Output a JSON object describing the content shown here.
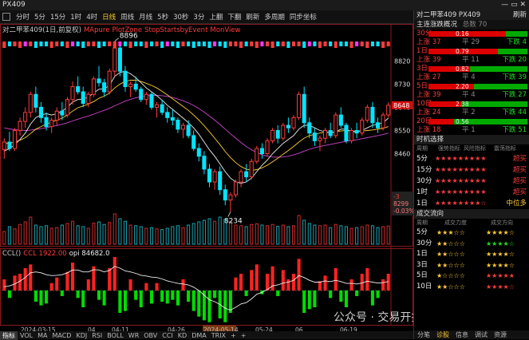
{
  "window": {
    "title": "PX409",
    "controls": "— ▭ ✕"
  },
  "toolbar": [
    "分时",
    "5分",
    "15分",
    "1时",
    "4时",
    "日线",
    "周线",
    "月线",
    "5秒",
    "30秒",
    "3分",
    "上翻",
    "下翻",
    "刷新",
    "多周期",
    "同步坐标"
  ],
  "toolbar_active": 5,
  "main": {
    "legend": [
      {
        "text": "对二甲苯409(1日,前复权)",
        "color": "#cccccc"
      },
      {
        "text": "MApure",
        "color": "#ff3b3b"
      },
      {
        "text": "PlotZone",
        "color": "#ff3b3b"
      },
      {
        "text": "StopStartsbyEvent",
        "color": "#ff3b3b"
      },
      {
        "text": "MonView",
        "color": "#ff3b3b"
      }
    ],
    "price_labels": [
      "8820",
      "8730",
      "8640",
      "8550",
      "8460"
    ],
    "price_values": [
      8820,
      8730,
      8640,
      8550,
      8460
    ],
    "ylim": [
      8220,
      8920
    ],
    "high_label": "8896",
    "low_label": "8234",
    "last_price": "8648",
    "side_tag": [
      "-3",
      "8299",
      "-0.03%"
    ]
  },
  "sub": {
    "legend": [
      {
        "text": "CCL()",
        "color": "#cccccc"
      },
      {
        "text": "CCL 1922.00",
        "color": "#ff3b3b"
      },
      {
        "text": "opi 84682.0",
        "color": "#eeeeee"
      }
    ]
  },
  "xaxis": [
    "2024-03-15",
    "04",
    "04-11",
    "04-26",
    "2024-05-14",
    "05-24",
    "06",
    "06-19"
  ],
  "bottom_tabs": [
    "指标",
    "VOL",
    "MA",
    "MACD",
    "KDJ",
    "RSI",
    "BOLL",
    "WR",
    "OBV",
    "CCI",
    "KD",
    "DMA",
    "TRIX",
    "+",
    "+"
  ],
  "watermark": "公众号 · 交易开拓者TB",
  "right": {
    "title": "对二甲苯409 PX409",
    "title_right": "刷新",
    "overview_title": "主连涨跌概况",
    "overview_sub": "总数 70",
    "periods": [
      {
        "label": "30分",
        "val": "0.16",
        "fill": 0.78,
        "up": "上涨 37",
        "flat": "平 29",
        "down": "下跌 4"
      },
      {
        "label": "1日",
        "val": "0.79",
        "fill": 0.7,
        "up": "上涨 39",
        "flat": "平 11",
        "down": "下跌 20"
      },
      {
        "label": "3日",
        "val": "0.82",
        "fill": 0.42,
        "up": "上涨 27",
        "flat": "平 4",
        "down": "下跌 39"
      },
      {
        "label": "5日",
        "val": "2.20",
        "fill": 0.46,
        "up": "上涨 39",
        "flat": "平 4",
        "down": "下跌 27"
      },
      {
        "label": "10日",
        "val": "2.38",
        "fill": 0.33,
        "up": "上涨 24",
        "flat": "平 2",
        "down": "下跌 44"
      },
      {
        "label": "20日",
        "val": "0.56",
        "fill": 0.26,
        "up": "上涨 18",
        "flat": "平 1",
        "down": "下跌 51"
      }
    ],
    "timing_title": "时机选择",
    "timing_cols": [
      "周期",
      "强势指标",
      "风险指标",
      "震荡指标"
    ],
    "timing_rows": [
      {
        "p": "5分",
        "stars": "★★★★★★★★★",
        "rating": "超买"
      },
      {
        "p": "15分",
        "stars": "★★★★★★★★★",
        "rating": "超买"
      },
      {
        "p": "30分",
        "stars": "★★★★★★★★★",
        "rating": "超买"
      },
      {
        "p": "1时",
        "stars": "★★★★★★★★★",
        "rating": "超买"
      },
      {
        "p": "1日",
        "stars": "★★★★★★★★☆",
        "rating": "中位多"
      }
    ],
    "flow_title": "成交流向",
    "flow_cols": [
      "周期",
      "成交力度",
      "成交方向"
    ],
    "flow_rows": [
      {
        "p": "5分",
        "a": "★★★☆☆",
        "b": "★★★★☆",
        "bc": "y"
      },
      {
        "p": "30分",
        "a": "★★☆☆☆",
        "b": "★★★★☆",
        "bc": "g"
      },
      {
        "p": "1日",
        "a": "★★☆☆☆",
        "b": "★★★★☆",
        "bc": "y"
      },
      {
        "p": "3日",
        "a": "★★☆☆☆",
        "b": "★★★★☆",
        "bc": "y"
      },
      {
        "p": "5日",
        "a": "★☆☆☆☆",
        "b": "★★★★★",
        "bc": "r"
      },
      {
        "p": "10日",
        "a": "★★☆☆☆",
        "b": "★★★★☆",
        "bc": "r"
      }
    ],
    "bottom_tabs": [
      "分笔",
      "诊股",
      "信息",
      "调试",
      "资源"
    ]
  },
  "colors": {
    "up": "#ff3b3b",
    "down": "#00e5ff",
    "ma1": "#eeeeee",
    "ma2": "#ffcc33",
    "ma3": "#cc44cc",
    "ccl_up": "#ff2222",
    "ccl_down": "#00dd00"
  },
  "chart_data": {
    "type": "candlestick",
    "ohlc": [
      [
        8475,
        8520,
        8440,
        8505
      ],
      [
        8505,
        8545,
        8470,
        8480
      ],
      [
        8480,
        8560,
        8470,
        8550
      ],
      [
        8550,
        8600,
        8530,
        8585
      ],
      [
        8585,
        8640,
        8560,
        8620
      ],
      [
        8620,
        8700,
        8600,
        8690
      ],
      [
        8690,
        8720,
        8620,
        8640
      ],
      [
        8640,
        8660,
        8580,
        8600
      ],
      [
        8600,
        8620,
        8550,
        8565
      ],
      [
        8565,
        8600,
        8540,
        8590
      ],
      [
        8590,
        8640,
        8570,
        8625
      ],
      [
        8625,
        8660,
        8590,
        8610
      ],
      [
        8610,
        8680,
        8600,
        8670
      ],
      [
        8670,
        8740,
        8650,
        8720
      ],
      [
        8720,
        8760,
        8690,
        8700
      ],
      [
        8700,
        8720,
        8640,
        8655
      ],
      [
        8655,
        8700,
        8640,
        8690
      ],
      [
        8690,
        8760,
        8680,
        8750
      ],
      [
        8750,
        8800,
        8720,
        8735
      ],
      [
        8735,
        8750,
        8680,
        8700
      ],
      [
        8700,
        8790,
        8690,
        8780
      ],
      [
        8780,
        8896,
        8760,
        8870
      ],
      [
        8870,
        8880,
        8760,
        8780
      ],
      [
        8780,
        8800,
        8700,
        8720
      ],
      [
        8720,
        8740,
        8680,
        8730
      ],
      [
        8730,
        8760,
        8700,
        8710
      ],
      [
        8710,
        8720,
        8660,
        8670
      ],
      [
        8670,
        8700,
        8650,
        8690
      ],
      [
        8690,
        8700,
        8630,
        8640
      ],
      [
        8640,
        8660,
        8600,
        8650
      ],
      [
        8650,
        8670,
        8610,
        8620
      ],
      [
        8620,
        8640,
        8580,
        8600
      ],
      [
        8600,
        8630,
        8570,
        8590
      ],
      [
        8590,
        8600,
        8540,
        8555
      ],
      [
        8555,
        8580,
        8520,
        8570
      ],
      [
        8570,
        8590,
        8520,
        8530
      ],
      [
        8530,
        8550,
        8470,
        8480
      ],
      [
        8480,
        8500,
        8430,
        8450
      ],
      [
        8450,
        8470,
        8380,
        8400
      ],
      [
        8400,
        8420,
        8330,
        8350
      ],
      [
        8350,
        8400,
        8320,
        8390
      ],
      [
        8390,
        8410,
        8300,
        8320
      ],
      [
        8320,
        8340,
        8260,
        8280
      ],
      [
        8280,
        8310,
        8234,
        8300
      ],
      [
        8300,
        8360,
        8290,
        8350
      ],
      [
        8350,
        8400,
        8330,
        8390
      ],
      [
        8390,
        8420,
        8350,
        8370
      ],
      [
        8370,
        8440,
        8360,
        8430
      ],
      [
        8430,
        8490,
        8420,
        8480
      ],
      [
        8480,
        8500,
        8440,
        8460
      ],
      [
        8460,
        8520,
        8450,
        8510
      ],
      [
        8510,
        8560,
        8500,
        8550
      ],
      [
        8550,
        8570,
        8500,
        8520
      ],
      [
        8520,
        8580,
        8510,
        8570
      ],
      [
        8570,
        8600,
        8540,
        8560
      ],
      [
        8560,
        8610,
        8550,
        8600
      ],
      [
        8600,
        8700,
        8590,
        8690
      ],
      [
        8690,
        8720,
        8560,
        8580
      ],
      [
        8580,
        8600,
        8520,
        8540
      ],
      [
        8540,
        8560,
        8490,
        8510
      ],
      [
        8510,
        8530,
        8470,
        8520
      ],
      [
        8520,
        8560,
        8500,
        8550
      ],
      [
        8550,
        8580,
        8520,
        8530
      ],
      [
        8530,
        8620,
        8520,
        8610
      ],
      [
        8610,
        8640,
        8560,
        8570
      ],
      [
        8570,
        8580,
        8500,
        8510
      ],
      [
        8510,
        8560,
        8500,
        8550
      ],
      [
        8550,
        8580,
        8520,
        8540
      ],
      [
        8540,
        8600,
        8530,
        8590
      ],
      [
        8590,
        8650,
        8580,
        8640
      ],
      [
        8640,
        8660,
        8560,
        8580
      ],
      [
        8580,
        8600,
        8540,
        8560
      ],
      [
        8560,
        8620,
        8550,
        8610
      ],
      [
        8610,
        8660,
        8600,
        8648
      ]
    ],
    "ma1": [
      8470,
      8480,
      8495,
      8515,
      8540,
      8575,
      8600,
      8610,
      8615,
      8610,
      8615,
      8625,
      8640,
      8660,
      8670,
      8672,
      8680,
      8695,
      8710,
      8712,
      8725,
      8760,
      8775,
      8780,
      8770,
      8755,
      8735,
      8715,
      8700,
      8685,
      8668,
      8648,
      8632,
      8615,
      8598,
      8580,
      8560,
      8535,
      8505,
      8475,
      8450,
      8420,
      8390,
      8365,
      8350,
      8345,
      8350,
      8365,
      8390,
      8415,
      8435,
      8460,
      8480,
      8500,
      8515,
      8530,
      8555,
      8570,
      8570,
      8560,
      8550,
      8545,
      8540,
      8545,
      8555,
      8555,
      8545,
      8545,
      8550,
      8560,
      8570,
      8575,
      8580,
      8598
    ],
    "ma2": [
      8500,
      8500,
      8505,
      8512,
      8522,
      8538,
      8555,
      8565,
      8575,
      8582,
      8590,
      8598,
      8610,
      8625,
      8638,
      8645,
      8652,
      8662,
      8675,
      8683,
      8695,
      8715,
      8730,
      8740,
      8745,
      8745,
      8740,
      8733,
      8725,
      8715,
      8702,
      8688,
      8673,
      8658,
      8643,
      8628,
      8610,
      8590,
      8568,
      8545,
      8520,
      8495,
      8468,
      8445,
      8425,
      8410,
      8400,
      8395,
      8398,
      8405,
      8415,
      8428,
      8442,
      8458,
      8472,
      8488,
      8505,
      8520,
      8530,
      8535,
      8540,
      8542,
      8542,
      8545,
      8548,
      8550,
      8548,
      8547,
      8548,
      8550,
      8552,
      8555,
      8558,
      8565
    ],
    "ma3": [
      8560,
      8556,
      8553,
      8551,
      8550,
      8551,
      8554,
      8557,
      8561,
      8565,
      8569,
      8574,
      8580,
      8587,
      8594,
      8600,
      8606,
      8613,
      8621,
      8628,
      8636,
      8646,
      8655,
      8664,
      8671,
      8677,
      8681,
      8684,
      8686,
      8686,
      8685,
      8682,
      8678,
      8672,
      8665,
      8657,
      8647,
      8635,
      8621,
      8606,
      8590,
      8573,
      8555,
      8537,
      8520,
      8503,
      8488,
      8475,
      8464,
      8456,
      8450,
      8447,
      8446,
      8447,
      8450,
      8455,
      8462,
      8470,
      8477,
      8483,
      8488,
      8492,
      8496,
      8500,
      8504,
      8508,
      8511,
      8514,
      8518,
      8522,
      8526,
      8530,
      8534,
      8540
    ],
    "volume": [
      40,
      55,
      48,
      62,
      70,
      85,
      60,
      55,
      58,
      50,
      52,
      60,
      65,
      72,
      58,
      55,
      50,
      66,
      70,
      62,
      68,
      95,
      80,
      72,
      60,
      58,
      55,
      50,
      52,
      48,
      46,
      50,
      55,
      58,
      52,
      60,
      65,
      70,
      75,
      80,
      72,
      85,
      78,
      70,
      60,
      58,
      55,
      62,
      64,
      60,
      58,
      62,
      56,
      60,
      55,
      58,
      90,
      75,
      65,
      60,
      58,
      60,
      52,
      62,
      58,
      55,
      50,
      52,
      55,
      60,
      58,
      52,
      55,
      57
    ],
    "ccl": [
      60,
      -40,
      80,
      90,
      120,
      140,
      -60,
      -80,
      -70,
      40,
      70,
      -30,
      100,
      150,
      -40,
      -90,
      60,
      130,
      -50,
      -80,
      120,
      180,
      -120,
      -110,
      60,
      -50,
      -90,
      40,
      -70,
      40,
      -60,
      -70,
      -50,
      -80,
      60,
      -60,
      -110,
      -140,
      -160,
      -170,
      -40,
      -150,
      -170,
      -120,
      70,
      90,
      -30,
      110,
      140,
      -20,
      90,
      130,
      -30,
      110,
      60,
      90,
      170,
      -120,
      -100,
      -90,
      50,
      80,
      -40,
      120,
      -60,
      -90,
      60,
      -30,
      90,
      120,
      -80,
      -40,
      60,
      90
    ],
    "ccl_line": [
      20,
      25,
      35,
      50,
      70,
      95,
      100,
      95,
      85,
      80,
      82,
      85,
      95,
      110,
      110,
      100,
      100,
      112,
      110,
      100,
      108,
      130,
      120,
      105,
      100,
      92,
      82,
      78,
      72,
      70,
      62,
      52,
      45,
      38,
      35,
      30,
      18,
      0,
      -25,
      -50,
      -60,
      -75,
      -95,
      -105,
      -90,
      -72,
      -65,
      -45,
      -20,
      -10,
      5,
      25,
      30,
      40,
      45,
      55,
      80,
      70,
      55,
      45,
      45,
      52,
      48,
      55,
      48,
      38,
      38,
      35,
      40,
      50,
      45,
      40,
      42,
      48
    ]
  }
}
